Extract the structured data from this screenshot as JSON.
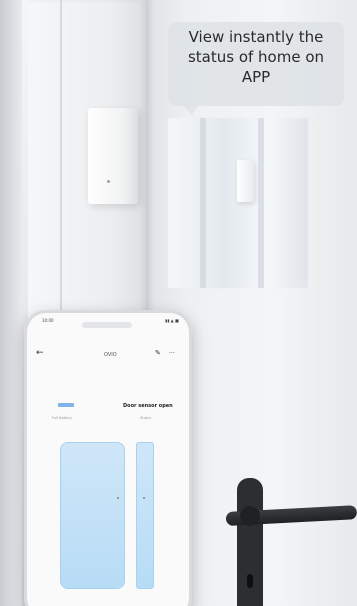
{
  "caption": {
    "line1": "View instantly the",
    "line2": "status of home on",
    "line3": "APP"
  },
  "phone_app": {
    "status_time": "10:00",
    "signal": "▮▮ ▲ ■",
    "back_icon": "←",
    "device_title": "OVIO",
    "edit_icon": "✎",
    "more_icon": "···",
    "door_status": "Door sensor open",
    "battery_label": "Full Battery",
    "status_label": "Status"
  },
  "colors": {
    "panel_blue": "#b7dcf6",
    "battery_blue": "#7fb3ea",
    "handle_black": "#1f2124"
  }
}
